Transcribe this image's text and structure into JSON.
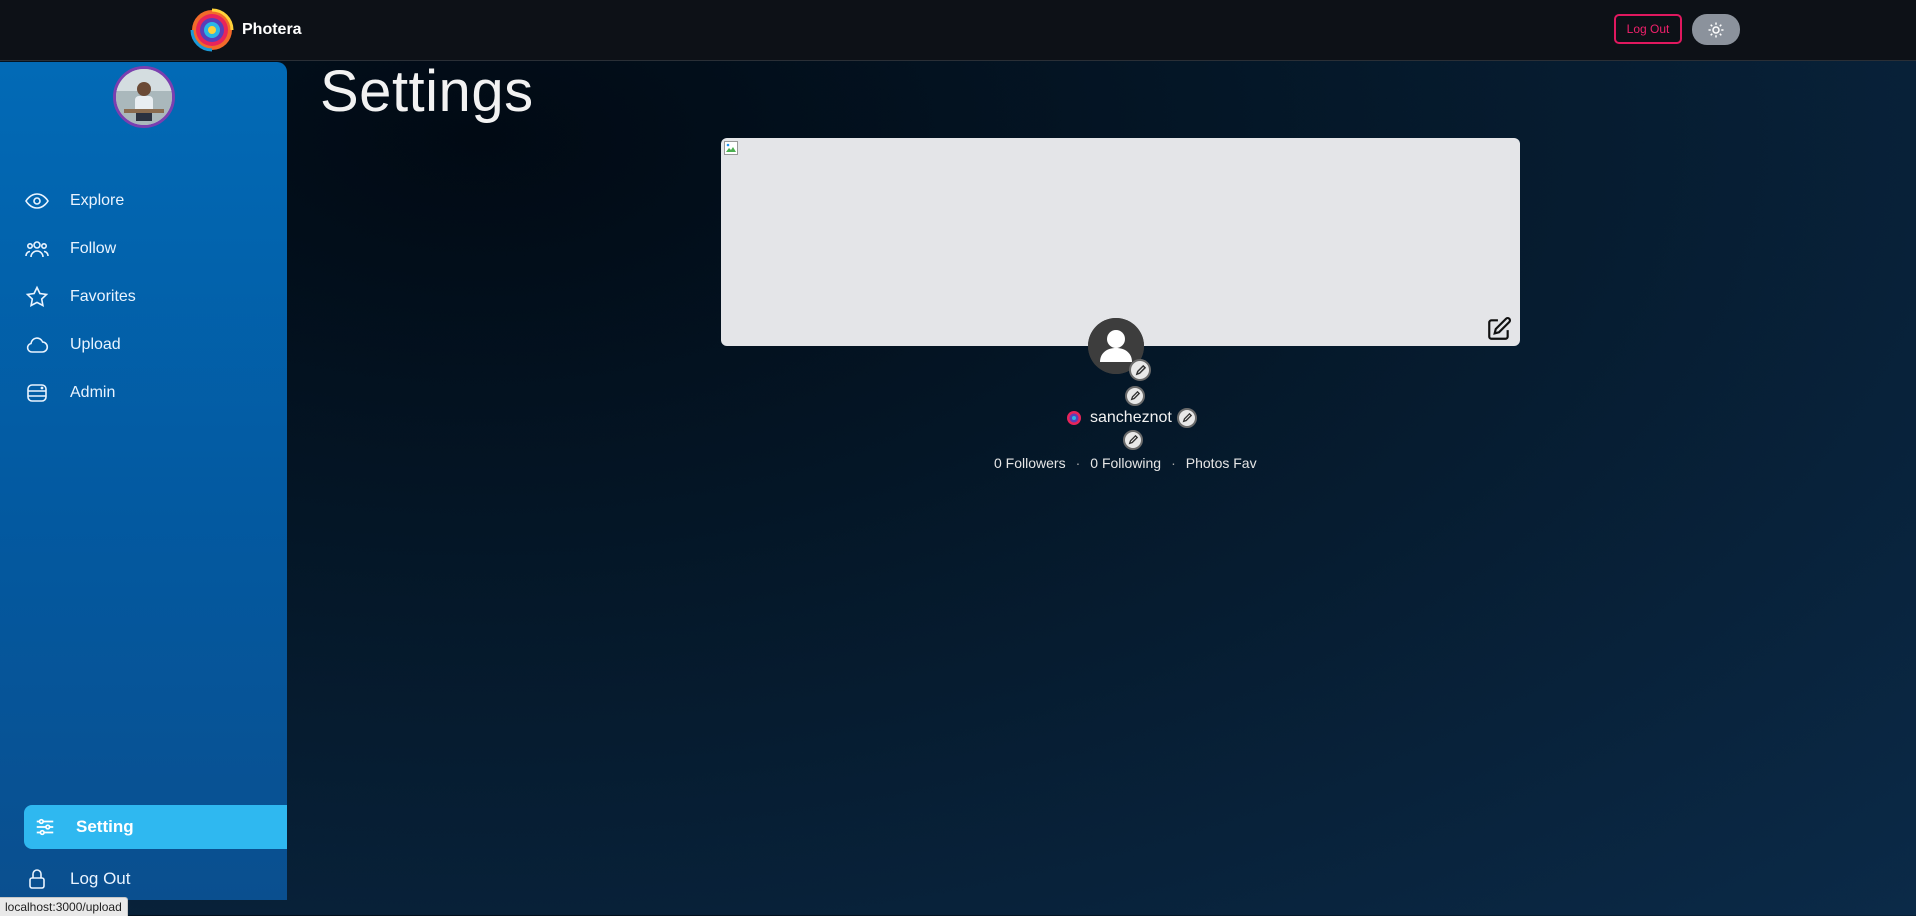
{
  "header": {
    "app_name": "Photera",
    "logout_label": "Log Out",
    "theme_toggle_icon": "sun-icon"
  },
  "sidebar": {
    "items": [
      {
        "label": "Explore",
        "icon": "eye-icon"
      },
      {
        "label": "Follow",
        "icon": "users-icon"
      },
      {
        "label": "Favorites",
        "icon": "star-icon"
      },
      {
        "label": "Upload",
        "icon": "cloud-icon"
      },
      {
        "label": "Admin",
        "icon": "database-icon"
      }
    ],
    "active_item": {
      "label": "Setting",
      "icon": "sliders-icon"
    },
    "logout": {
      "label": "Log Out",
      "icon": "lock-icon"
    }
  },
  "main": {
    "title": "Settings",
    "username": "sancheznot",
    "stats": {
      "followers": "0 Followers",
      "following": "0 Following",
      "photos_fav": "Photos Fav",
      "separator": "·"
    }
  },
  "status_bar": {
    "url": "localhost:3000/upload"
  },
  "colors": {
    "accent": "#2fb8f0",
    "sidebar": "#026ab6",
    "logout_border": "#e0185f"
  }
}
